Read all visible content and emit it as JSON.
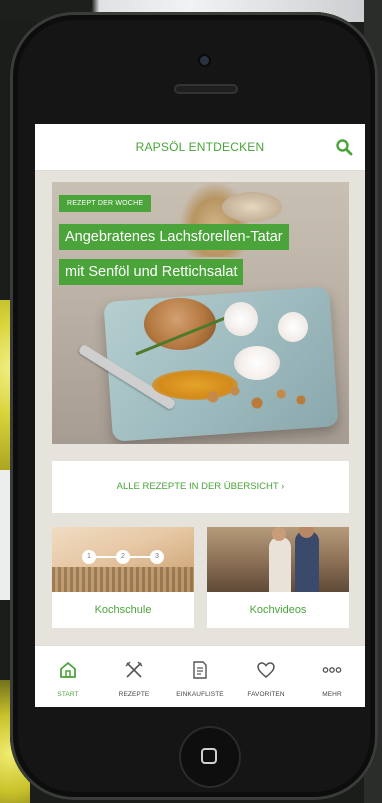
{
  "app": {
    "title": "RAPSÖL ENTDECKEN"
  },
  "hero": {
    "badge": "REZEPT DER WOCHE",
    "title_line_1": "Angebratenes Lachsforellen-Tatar",
    "title_line_2": "mit Senföl und Rettichsalat"
  },
  "all_recipes_label": "ALLE REZEPTE IN DER ÜBERSICHT ›",
  "cards": [
    {
      "label": "Kochschule",
      "steps": [
        "1",
        "2",
        "3"
      ]
    },
    {
      "label": "Kochvideos"
    }
  ],
  "tabs": [
    {
      "label": "START",
      "icon": "home-icon",
      "active": true
    },
    {
      "label": "REZEPTE",
      "icon": "utensils-icon",
      "active": false
    },
    {
      "label": "EINKAUFLISTE",
      "icon": "list-icon",
      "active": false
    },
    {
      "label": "FAVORITEN",
      "icon": "heart-icon",
      "active": false
    },
    {
      "label": "MEHR",
      "icon": "more-icon",
      "active": false
    }
  ],
  "colors": {
    "accent": "#4aa43a",
    "tab_inactive": "#444444"
  }
}
